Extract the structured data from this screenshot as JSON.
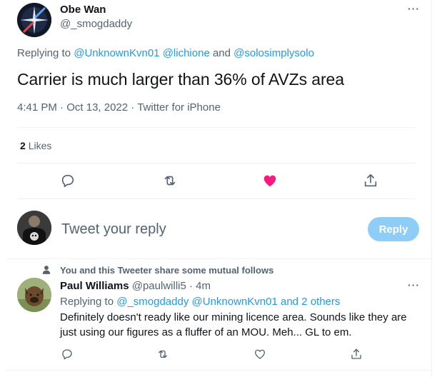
{
  "main_tweet": {
    "display_name": "Obe Wan",
    "handle": "@_smogdaddy",
    "replying_prefix": "Replying to",
    "mentions": [
      "@UnknownKvn01",
      "@lichione"
    ],
    "mentions_and": "and",
    "mention_last": "@solosimplysolo",
    "text": "Carrier is much larger than 36% of AVZs area",
    "time": "4:41 PM",
    "separator": "·",
    "date": "Oct 13, 2022",
    "source": "Twitter for iPhone",
    "likes_count": "2",
    "likes_label": "Likes",
    "more_icon": "more-icon"
  },
  "composer": {
    "placeholder": "Tweet your reply",
    "button_label": "Reply"
  },
  "reply": {
    "mutual_text": "You and this Tweeter share some mutual follows",
    "display_name": "Paul Williams",
    "handle": "@paulwilli5",
    "separator": "·",
    "time": "4m",
    "replying_prefix": "Replying to",
    "mentions": [
      "@_smogdaddy",
      "@UnknownKvn01"
    ],
    "mentions_and": "and 2 others",
    "text": "Definitely doesn't ready like our mining licence area. Sounds like they are just using our figures as a fluffer of an MOU. Meh... GL to em."
  },
  "colors": {
    "accent": "#1d9bf0",
    "liked": "#f91880",
    "reply_button": "#8ecdf8",
    "muted": "#536471"
  }
}
